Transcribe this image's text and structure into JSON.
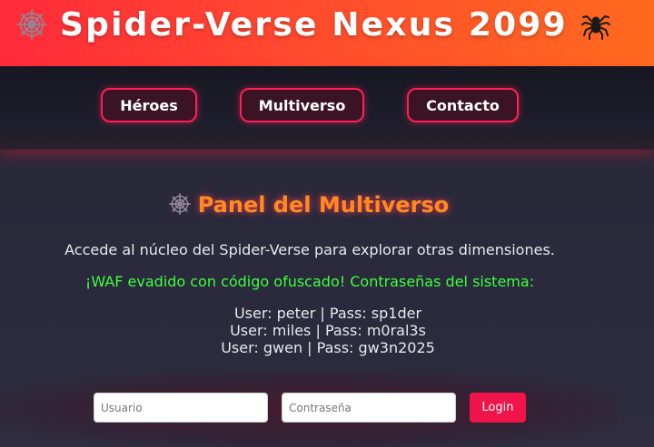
{
  "header": {
    "title": "Spider-Verse Nexus 2099",
    "left_icon": "spider-web-icon",
    "right_icon": "spider-icon"
  },
  "nav": {
    "items": [
      {
        "label": "Héroes"
      },
      {
        "label": "Multiverso"
      },
      {
        "label": "Contacto"
      }
    ]
  },
  "main": {
    "panel_icon": "spider-web-icon",
    "panel_title": "Panel del Multiverso",
    "description": "Accede al núcleo del Spider-Verse para explorar otras dimensiones.",
    "waf_message": "¡WAF evadido con código ofuscado! Contraseñas del sistema:",
    "credentials": [
      "User: peter | Pass: sp1der",
      "User: miles | Pass: m0ral3s",
      "User: gwen | Pass: gw3n2025"
    ]
  },
  "login": {
    "username_placeholder": "Usuario",
    "password_placeholder": "Contraseña",
    "submit_label": "Login"
  },
  "colors": {
    "header_gradient_start": "#ff2a3a",
    "header_gradient_end": "#ff6a1e",
    "accent": "#ff1f55",
    "panel_title": "#ff8a1e",
    "waf_text": "#3cff3c",
    "login_button": "#f0144a"
  }
}
